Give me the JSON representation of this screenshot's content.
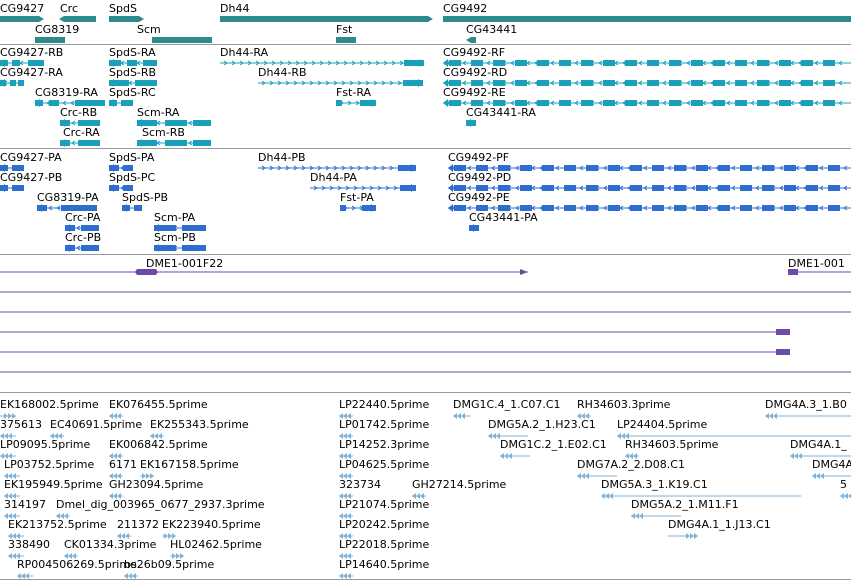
{
  "colors": {
    "gene": "#2e8b8b",
    "transcript": "#1aa0b8",
    "protein": "#2e6ecf",
    "clone": "#6b4aa8",
    "est": "#7fb2d9",
    "separator": "#9a9a9a"
  },
  "tracks": {
    "genes": {
      "labels": [
        "CG9427",
        "Crc",
        "SpdS",
        "Dh44",
        "CG9492",
        "CG8319",
        "Scm",
        "Fst",
        "CG43441"
      ]
    },
    "transcripts": {
      "labels": [
        "CG9427-RB",
        "SpdS-RA",
        "Dh44-RA",
        "CG9492-RF",
        "CG9427-RA",
        "SpdS-RB",
        "Dh44-RB",
        "CG9492-RD",
        "CG8319-RA",
        "SpdS-RC",
        "Fst-RA",
        "CG9492-RE",
        "Crc-RB",
        "Scm-RA",
        "CG43441-RA",
        "Crc-RA",
        "Scm-RB"
      ]
    },
    "proteins": {
      "labels": [
        "CG9427-PA",
        "SpdS-PA",
        "Dh44-PB",
        "CG9492-PF",
        "CG9427-PB",
        "SpdS-PC",
        "Dh44-PA",
        "CG9492-PD",
        "CG8319-PA",
        "SpdS-PB",
        "Fst-PA",
        "CG9492-PE",
        "Crc-PA",
        "Scm-PA",
        "CG43441-PA",
        "Crc-PB",
        "Scm-PB"
      ]
    },
    "clones": {
      "labels": [
        "DME1-001F22",
        "DME1-001"
      ]
    },
    "ests": {
      "labels": [
        "EK168002.5prime",
        "EK076455.5prime",
        "LP22440.5prime",
        "DMG1C.4_1.C07.C1",
        "RH34603.3prime",
        "DMG4A.3_1.B0",
        "375613",
        "EC40691.5prime",
        "EK255343.5prime",
        "LP01742.5prime",
        "DMG5A.2_1.H23.C1",
        "LP24404.5prime",
        "LP09095.5prime",
        "EK006842.5prime",
        "LP14252.3prime",
        "DMG1C.2_1.E02.C1",
        "RH34603.5prime",
        "DMG4A.1_",
        "LP03752.5prime",
        "6171",
        "EK167158.5prime",
        "LP04625.5prime",
        "DMG7A.2_2.D08.C1",
        "DMG4A",
        "EK195949.5prime",
        "GH23094.5prime",
        "323734",
        "GH27214.5prime",
        "DMG5A.3_1.K19.C1",
        "5",
        "314197",
        "Dmel_dig_003965_0677_2937.3prime",
        "LP21074.5prime",
        "DMG5A.2_1.M11.F1",
        "EK213752.5prime",
        "211372",
        "EK223940.5prime",
        "LP20242.5prime",
        "DMG4A.1_1.J13.C1",
        "338490",
        "CK01334.3prime",
        "HL02462.5prime",
        "LP22018.5prime",
        "RP004506269.5prime",
        "bs26b09.5prime",
        "LP14640.5prime"
      ]
    }
  }
}
